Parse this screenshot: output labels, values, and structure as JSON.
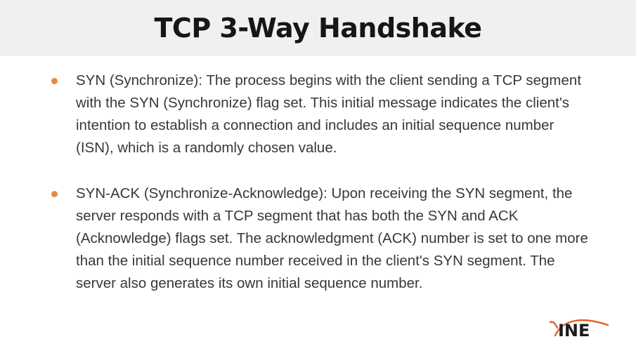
{
  "slide": {
    "title": "TCP 3-Way Handshake"
  },
  "bullets": [
    {
      "text": "SYN (Synchronize): The process begins with the client sending a TCP segment with the SYN (Synchronize) flag set. This initial message indicates the client's intention to establish a connection and includes an initial sequence number (ISN), which is a randomly chosen value."
    },
    {
      "text": "SYN-ACK (Synchronize-Acknowledge): Upon receiving the SYN segment, the server responds with a TCP segment that has both the SYN and ACK (Acknowledge) flags set. The acknowledgment (ACK) number is set to one more than the initial sequence number received in the client's SYN segment. The server also generates its own initial sequence number."
    }
  ],
  "logo": {
    "text": "INE",
    "accent_color": "#e3612a",
    "icon": "ine-logo"
  },
  "colors": {
    "header_bg": "#f0f0f0",
    "bullet": "#e38d42",
    "title": "#161616",
    "body_text": "#383838"
  }
}
